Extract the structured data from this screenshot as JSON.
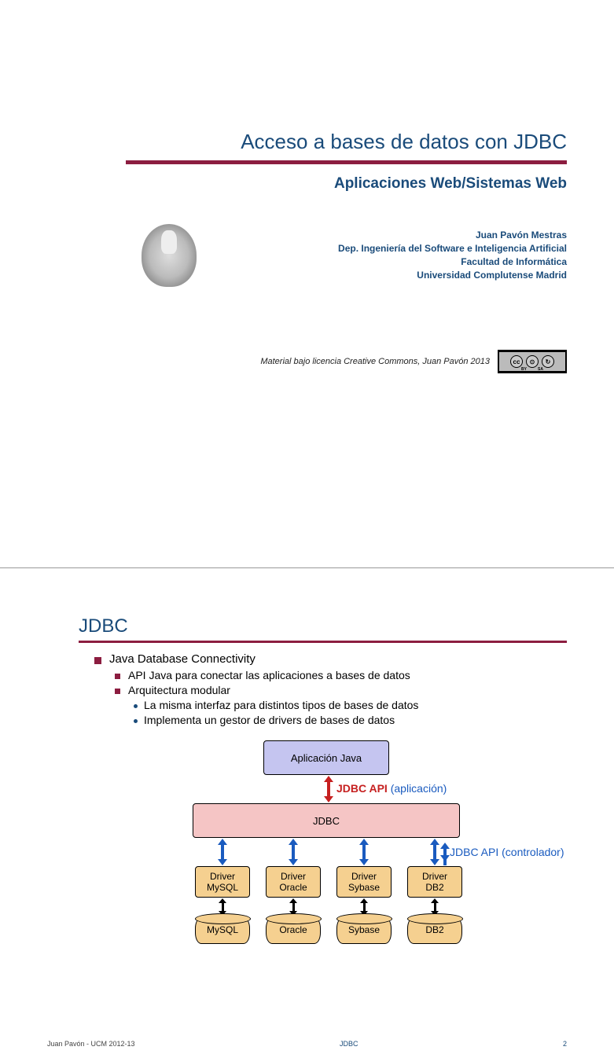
{
  "slide1": {
    "title": "Acceso a bases de datos con JDBC",
    "subtitle": "Aplicaciones Web/Sistemas Web",
    "author": {
      "name": "Juan Pavón Mestras",
      "dept": "Dep. Ingeniería del Software e Inteligencia Artificial",
      "faculty": "Facultad de Informática",
      "university": "Universidad Complutense Madrid"
    },
    "license_text": "Material bajo licencia Creative Commons, Juan Pavón 2013",
    "cc": {
      "by": "BY",
      "sa": "SA"
    }
  },
  "slide2": {
    "heading": "JDBC",
    "bullets": {
      "l1": "Java Database Connectivity",
      "l2a": "API Java para conectar las aplicaciones a bases de datos",
      "l2b": "Arquitectura modular",
      "l3a": "La misma interfaz para distintos tipos de bases de datos",
      "l3b": "Implementa un gestor de drivers de bases de datos"
    },
    "diagram": {
      "app": "Aplicación Java",
      "jdbc": "JDBC",
      "api_app_bold": "JDBC API",
      "api_app_paren": "(aplicación)",
      "api_ctl": "JDBC API (controlador)",
      "drivers": [
        {
          "line1": "Driver",
          "line2": "MySQL"
        },
        {
          "line1": "Driver",
          "line2": "Oracle"
        },
        {
          "line1": "Driver",
          "line2": "Sybase"
        },
        {
          "line1": "Driver",
          "line2": "DB2"
        }
      ],
      "dbs": [
        "MySQL",
        "Oracle",
        "Sybase",
        "DB2"
      ]
    },
    "footer": {
      "left": "Juan Pavón - UCM 2012-13",
      "center": "JDBC",
      "right": "2"
    }
  }
}
